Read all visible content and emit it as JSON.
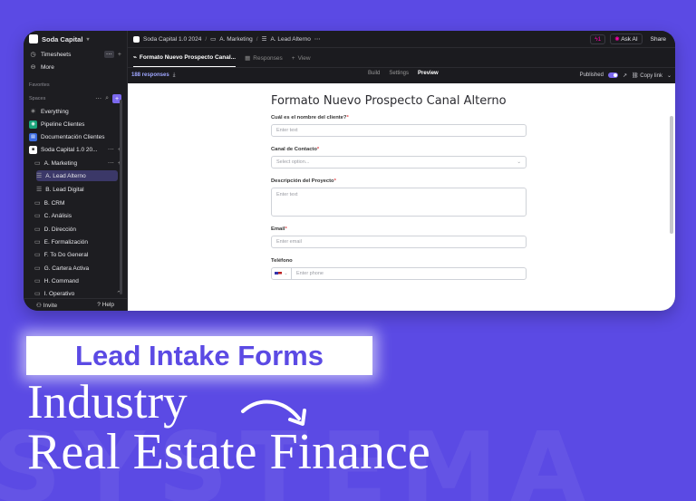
{
  "background": {
    "watermark": "SYSTEMA",
    "color": "#5b4ae4"
  },
  "sidebar": {
    "workspace": "Soda Capital",
    "top_items": [
      {
        "label": "Timesheets",
        "icon": "clock-icon"
      },
      {
        "label": "More",
        "icon": "more-circle-icon"
      }
    ],
    "favorites_label": "Favorites",
    "spaces_label": "Spaces",
    "spaces": [
      {
        "label": "Everything",
        "icon": "everything-icon"
      },
      {
        "label": "Pipeline Clientes",
        "icon": "pipeline-icon",
        "color": "#1aa37a"
      },
      {
        "label": "Documentación Clientes",
        "icon": "doc-icon",
        "color": "#3b6be0"
      },
      {
        "label": "Soda Capital 1.0 20...",
        "icon": "space-icon",
        "color": "#ffffff"
      }
    ],
    "folder_marketing": "A. Marketing",
    "lists": [
      {
        "label": "A. Lead Alterno",
        "active": true
      },
      {
        "label": "B. Lead Digital",
        "active": false
      }
    ],
    "folders": [
      "B. CRM",
      "C. Análisis",
      "D. Dirección",
      "E. Formalización",
      "F. To Do General",
      "G. Cartera Activa",
      "H. Command",
      "I. Operativo"
    ],
    "invite_label": "Invite",
    "help_label": "Help"
  },
  "topbar": {
    "crumb1": "Soda Capital 1.0 2024",
    "crumb2": "A. Marketing",
    "crumb3": "A. Lead Alterno",
    "badge": "1",
    "ask_ai": "Ask AI",
    "share": "Share"
  },
  "tabs": {
    "form_tab": "Formato Nuevo Prospecto Canal...",
    "responses_tab": "Responses",
    "view_tab": "View"
  },
  "subbar": {
    "responses_count": "188 responses",
    "build": "Build",
    "settings": "Settings",
    "preview": "Preview",
    "published": "Published",
    "copy_link": "Copy link"
  },
  "form": {
    "title": "Formato Nuevo Prospecto Canal Alterno",
    "q_client": "Cuál es el nombre del cliente?",
    "q_client_ph": "Enter text",
    "q_canal": "Canal de Contacto",
    "q_canal_ph": "Select option...",
    "q_desc": "Descripción del Proyecto",
    "q_desc_ph": "Enter text",
    "q_email": "Email",
    "q_email_ph": "Enter email",
    "q_phone": "Teléfono",
    "q_phone_ph": "Enter phone",
    "req_mark": "*"
  },
  "headline": {
    "tag": "Lead Intake Forms",
    "line1": "Industry",
    "line2": "Real Estate Finance"
  }
}
